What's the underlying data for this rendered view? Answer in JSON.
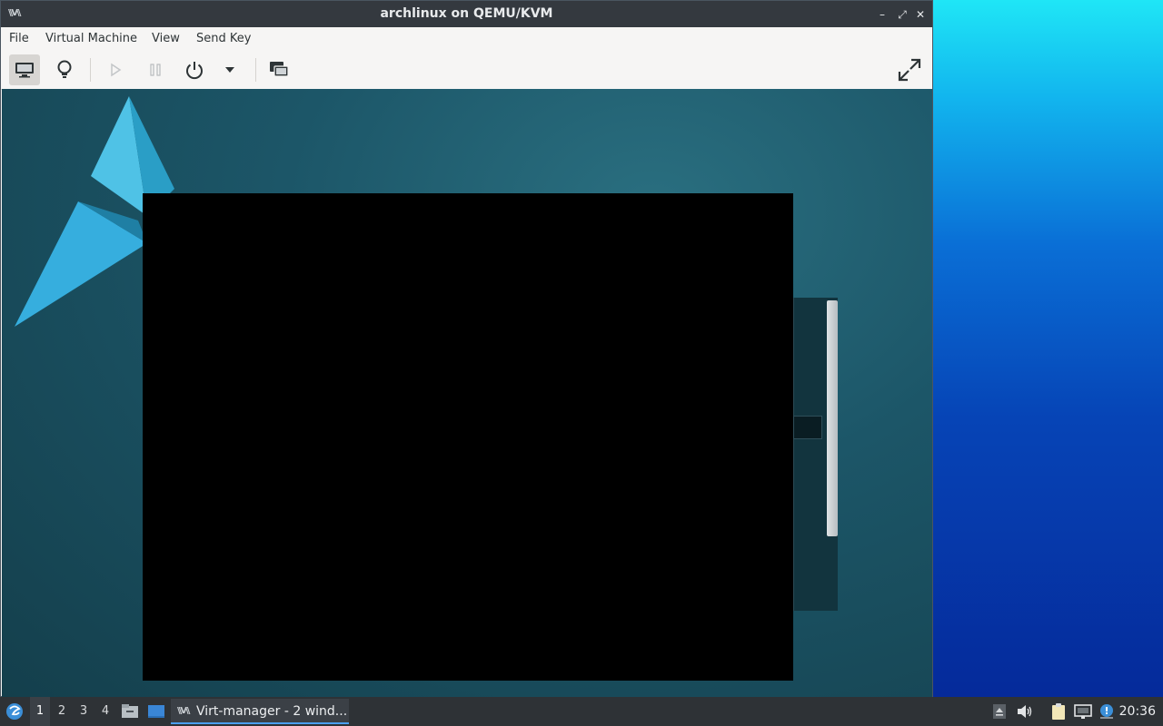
{
  "window": {
    "title": "archlinux on QEMU/KVM",
    "logo_text": "\\\\V\\\\",
    "minimize": "–",
    "maximize": "⤢",
    "close": "✕"
  },
  "menu": {
    "items": [
      "File",
      "Virtual Machine",
      "View",
      "Send Key"
    ]
  },
  "toolbar": {
    "buttons": [
      {
        "icon": "monitor-icon",
        "state": "active"
      },
      {
        "icon": "lightbulb-icon",
        "state": "normal"
      },
      {
        "icon": "play-icon",
        "state": "disabled"
      },
      {
        "icon": "pause-icon",
        "state": "disabled"
      },
      {
        "icon": "power-icon",
        "state": "normal"
      },
      {
        "icon": "chevron-down-icon",
        "state": "normal"
      },
      {
        "icon": "snapshots-icon",
        "state": "normal"
      },
      {
        "icon": "fullscreen-icon",
        "state": "normal"
      }
    ]
  },
  "taskbar": {
    "workspaces": [
      "1",
      "2",
      "3",
      "4"
    ],
    "current_workspace": "1",
    "task_label": "Virt-manager - 2 wind...",
    "task_logo": "\\\\V\\\\",
    "clock": "20:36"
  },
  "colors": {
    "titlebar": "#34393f",
    "taskbar": "#2e3236",
    "accent": "#4a9ff0"
  }
}
